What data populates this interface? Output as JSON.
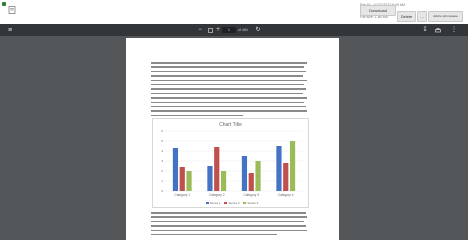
{
  "header": {
    "filename": "File 40 - 10/27/2022 6:09 AM",
    "filesize": "File size: 1.86 MB",
    "download_label": "Download",
    "delete_label": "Delete",
    "more_label": "…",
    "add_label": "Add to print queue"
  },
  "viewer": {
    "page_number": "1",
    "page_count": "of 464",
    "zoom_out_symbol": "−",
    "zoom_in_symbol": "+"
  },
  "colors": {
    "series1": "#4472c4",
    "series2": "#c0504d",
    "series3": "#9bbb59"
  },
  "chart_data": {
    "type": "bar",
    "title": "Chart Title",
    "categories": [
      "Category 1",
      "Category 2",
      "Category 3",
      "Category 4"
    ],
    "series": [
      {
        "name": "Series 1",
        "values": [
          4.3,
          2.5,
          3.5,
          4.5
        ]
      },
      {
        "name": "Series 2",
        "values": [
          2.4,
          4.4,
          1.8,
          2.8
        ]
      },
      {
        "name": "Series 3",
        "values": [
          2.0,
          2.0,
          3.0,
          5.0
        ]
      }
    ],
    "ylim": [
      0,
      6
    ],
    "yticks": [
      "0",
      "1",
      "2",
      "3",
      "4",
      "5",
      "6"
    ],
    "grid": true,
    "legend": "bottom"
  }
}
